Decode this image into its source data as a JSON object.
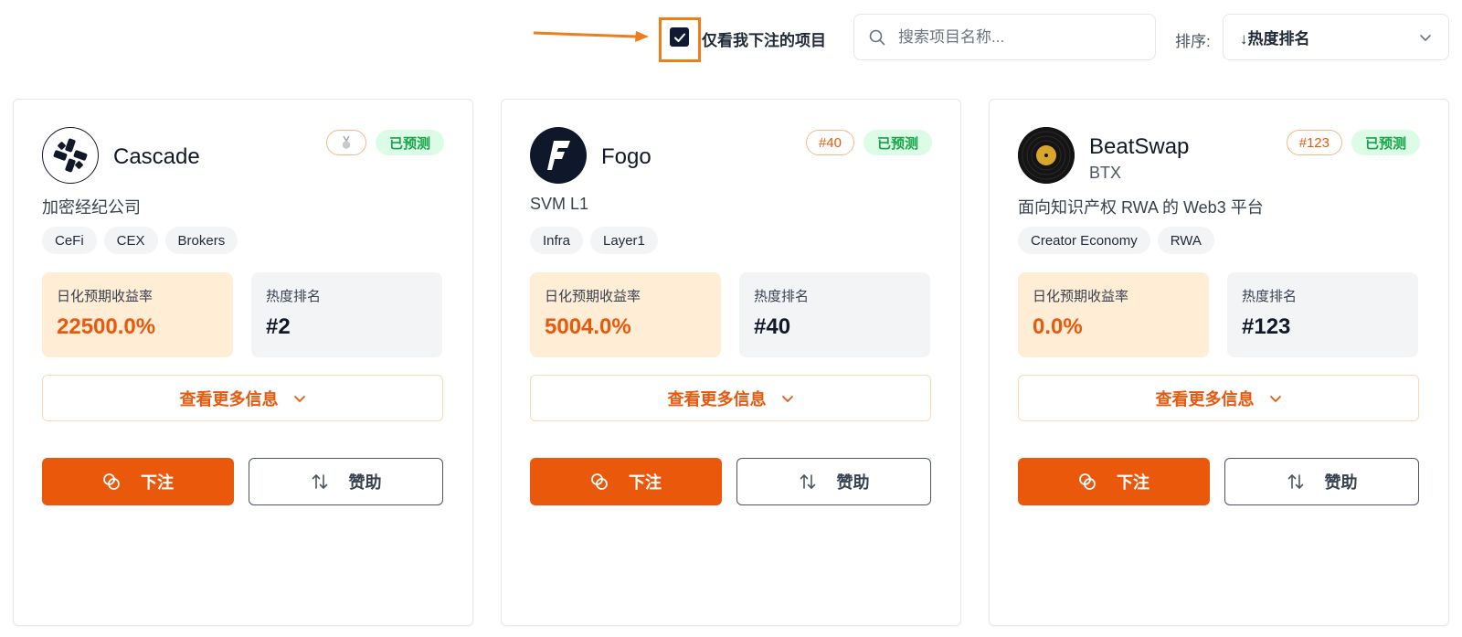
{
  "toolbar": {
    "checkbox_label": "仅看我下注的项目",
    "checkbox_checked": true,
    "search_placeholder": "搜索项目名称...",
    "sort_label": "排序:",
    "sort_value": "↓热度排名"
  },
  "colors": {
    "accent": "#ea580c",
    "annotation": "#ef7d1a",
    "success_bg": "#dcfce7",
    "success_text": "#16a34a"
  },
  "cards": [
    {
      "name": "Cascade",
      "subtitle": "",
      "logo_icon": "cascade-logo",
      "rank_badge": "",
      "rank_badge_icon": "medal-icon",
      "status_badge": "已预测",
      "description": "加密经纪公司",
      "tags": [
        "CeFi",
        "CEX",
        "Brokers"
      ],
      "yield_label": "日化预期收益率",
      "yield_value": "22500.0%",
      "heat_label": "热度排名",
      "heat_value": "#2",
      "more_label": "查看更多信息",
      "bet_label": "下注",
      "sponsor_label": "赞助"
    },
    {
      "name": "Fogo",
      "subtitle": "",
      "logo_icon": "fogo-logo",
      "rank_badge": "#40",
      "status_badge": "已预测",
      "description": "SVM L1",
      "tags": [
        "Infra",
        "Layer1"
      ],
      "yield_label": "日化预期收益率",
      "yield_value": "5004.0%",
      "heat_label": "热度排名",
      "heat_value": "#40",
      "more_label": "查看更多信息",
      "bet_label": "下注",
      "sponsor_label": "赞助"
    },
    {
      "name": "BeatSwap",
      "subtitle": "BTX",
      "logo_icon": "vinyl-record-logo",
      "rank_badge": "#123",
      "status_badge": "已预测",
      "description": "面向知识产权 RWA 的 Web3 平台",
      "tags": [
        "Creator Economy",
        "RWA"
      ],
      "yield_label": "日化预期收益率",
      "yield_value": "0.0%",
      "heat_label": "热度排名",
      "heat_value": "#123",
      "more_label": "查看更多信息",
      "bet_label": "下注",
      "sponsor_label": "赞助"
    }
  ]
}
